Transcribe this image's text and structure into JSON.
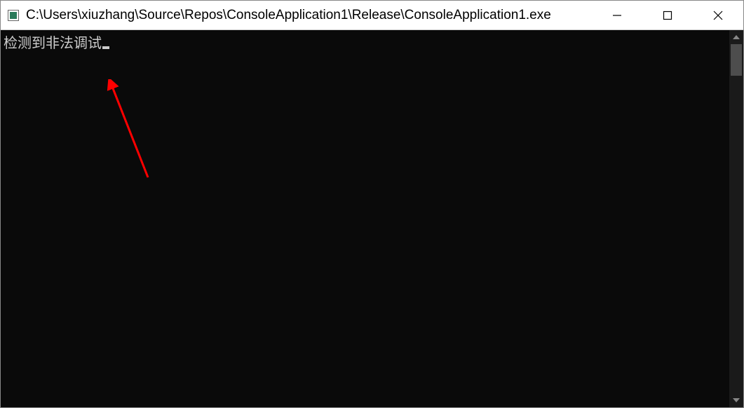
{
  "window": {
    "title": "C:\\Users\\xiuzhang\\Source\\Repos\\ConsoleApplication1\\Release\\ConsoleApplication1.exe"
  },
  "console": {
    "output": "检测到非法调试"
  }
}
